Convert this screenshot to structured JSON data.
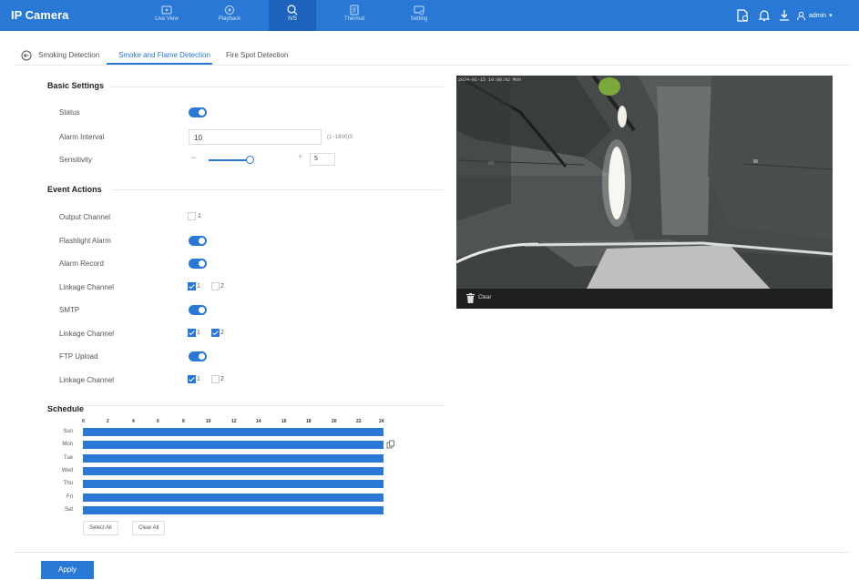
{
  "app": {
    "title": "IP Camera"
  },
  "nav": [
    {
      "label": "Live View",
      "icon": "live-view-icon",
      "active": false
    },
    {
      "label": "Playback",
      "icon": "playback-icon",
      "active": false
    },
    {
      "label": "IVS",
      "icon": "ivs-icon",
      "active": true
    },
    {
      "label": "Thermal",
      "icon": "thermal-icon",
      "active": false
    },
    {
      "label": "Setting",
      "icon": "setting-icon",
      "active": false
    }
  ],
  "user": {
    "name": "admin",
    "caret": "▾"
  },
  "tabs": [
    {
      "label": "Smoking Detection",
      "active": false
    },
    {
      "label": "Smoke and Flame Detection",
      "active": true
    },
    {
      "label": "Fire Spot Detection",
      "active": false
    }
  ],
  "basic_settings": {
    "title": "Basic Settings",
    "status_label": "Status",
    "status_on": true,
    "alarm_interval_label": "Alarm Interval",
    "alarm_interval_value": "10",
    "alarm_interval_range": "(1~1800)S",
    "sensitivity_label": "Sensitivity",
    "sensitivity_value": "5",
    "sensitivity_max": 10,
    "sensitivity_minus": "−",
    "sensitivity_plus": "+"
  },
  "event_actions": {
    "title": "Event Actions",
    "output_channel": {
      "label": "Output Channel",
      "options": [
        {
          "label": "1",
          "checked": false
        }
      ]
    },
    "flashlight_alarm": {
      "label": "Flashlight Alarm",
      "on": true
    },
    "alarm_record": {
      "label": "Alarm Record",
      "on": true
    },
    "record_linkage": {
      "label": "Linkage Channel",
      "options": [
        {
          "label": "1",
          "checked": true
        },
        {
          "label": "2",
          "checked": false
        }
      ]
    },
    "smtp": {
      "label": "SMTP",
      "on": true
    },
    "smtp_linkage": {
      "label": "Linkage Channel",
      "options": [
        {
          "label": "1",
          "checked": true
        },
        {
          "label": "2",
          "checked": true
        }
      ]
    },
    "ftp_upload": {
      "label": "FTP Upload",
      "on": true
    },
    "ftp_linkage": {
      "label": "Linkage Channel",
      "options": [
        {
          "label": "1",
          "checked": true
        },
        {
          "label": "2",
          "checked": false
        }
      ]
    }
  },
  "schedule": {
    "title": "Schedule",
    "hours": [
      "0",
      "2",
      "4",
      "6",
      "8",
      "10",
      "12",
      "14",
      "16",
      "18",
      "20",
      "22",
      "24"
    ],
    "days": [
      "Sun",
      "Mon",
      "Tue",
      "Wed",
      "Thu",
      "Fri",
      "Sat"
    ],
    "select_all": "Select All",
    "clear_all": "Clear All"
  },
  "apply_label": "Apply",
  "video": {
    "osd": "2024-01-15 10:08:02 Mon",
    "clear_label": "Clear"
  },
  "colors": {
    "accent": "#2a78d6",
    "nav_active": "#1d63bd"
  }
}
